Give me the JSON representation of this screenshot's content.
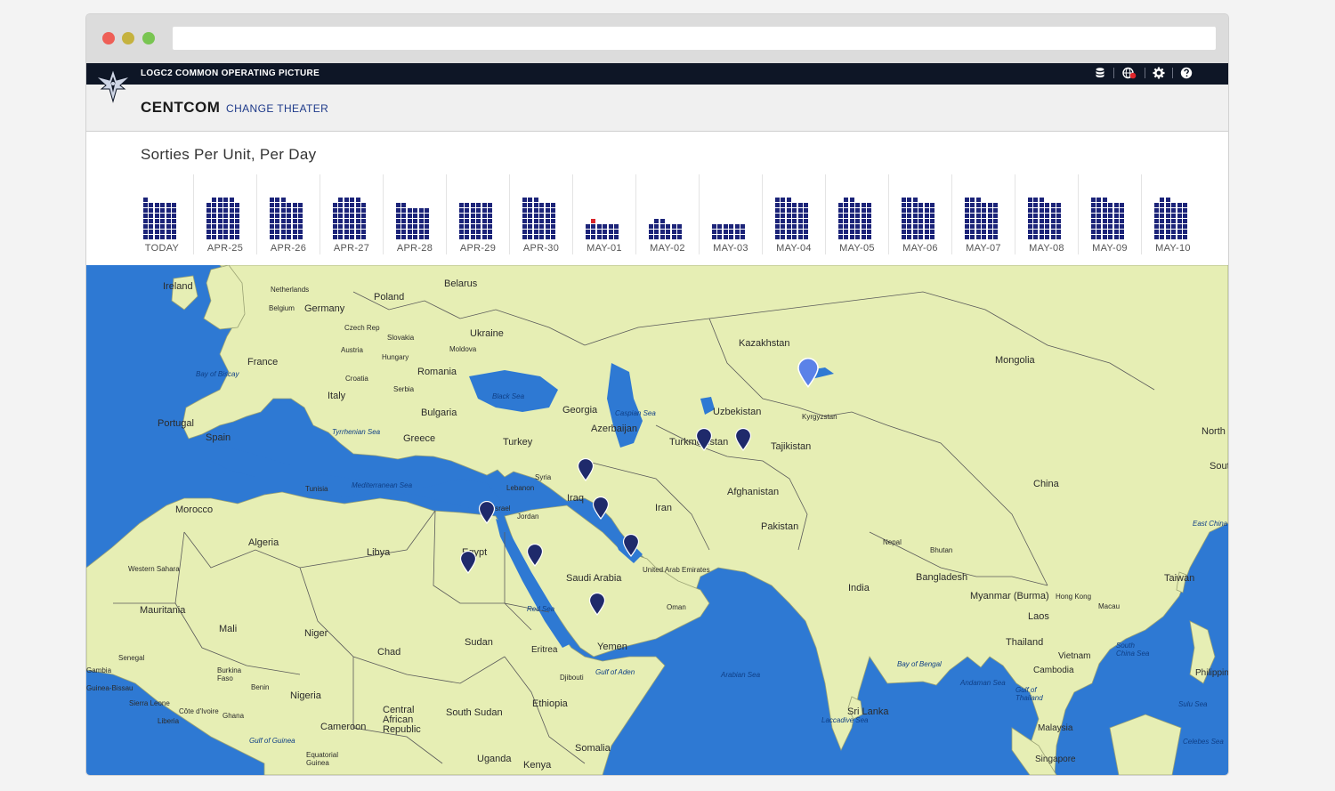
{
  "app": {
    "title": "LOGC2 COMMON OPERATING PICTURE",
    "theater": "CENTCOM",
    "change_theater": "CHANGE THEATER",
    "top_icons": [
      "database-icon",
      "globe-alert-icon",
      "gear-icon",
      "help-icon"
    ]
  },
  "sorties": {
    "title": "Sorties Per Unit, Per Day",
    "days": [
      {
        "label": "TODAY",
        "columns": [
          8,
          7,
          7,
          7,
          7,
          7
        ],
        "alert_cells": 0
      },
      {
        "label": "APR-25",
        "columns": [
          7,
          8,
          8,
          8,
          8,
          7
        ],
        "alert_cells": 0
      },
      {
        "label": "APR-26",
        "columns": [
          8,
          8,
          8,
          7,
          7,
          7
        ],
        "alert_cells": 0
      },
      {
        "label": "APR-27",
        "columns": [
          7,
          8,
          8,
          8,
          8,
          7
        ],
        "alert_cells": 0
      },
      {
        "label": "APR-28",
        "columns": [
          7,
          7,
          6,
          6,
          6,
          6
        ],
        "alert_cells": 0
      },
      {
        "label": "APR-29",
        "columns": [
          7,
          7,
          7,
          7,
          7,
          7
        ],
        "alert_cells": 0
      },
      {
        "label": "APR-30",
        "columns": [
          8,
          8,
          8,
          7,
          7,
          7
        ],
        "alert_cells": 0
      },
      {
        "label": "MAY-01",
        "columns": [
          3,
          4,
          3,
          3,
          3,
          3
        ],
        "alert_cells": 1
      },
      {
        "label": "MAY-02",
        "columns": [
          3,
          4,
          4,
          3,
          3,
          3
        ],
        "alert_cells": 0
      },
      {
        "label": "MAY-03",
        "columns": [
          3,
          3,
          3,
          3,
          3,
          3
        ],
        "alert_cells": 0
      },
      {
        "label": "MAY-04",
        "columns": [
          8,
          8,
          8,
          7,
          7,
          7
        ],
        "alert_cells": 0
      },
      {
        "label": "MAY-05",
        "columns": [
          7,
          8,
          8,
          7,
          7,
          7
        ],
        "alert_cells": 0
      },
      {
        "label": "MAY-06",
        "columns": [
          8,
          8,
          8,
          7,
          7,
          7
        ],
        "alert_cells": 0
      },
      {
        "label": "MAY-07",
        "columns": [
          8,
          8,
          8,
          7,
          7,
          7
        ],
        "alert_cells": 0
      },
      {
        "label": "MAY-08",
        "columns": [
          8,
          8,
          8,
          7,
          7,
          7
        ],
        "alert_cells": 0
      },
      {
        "label": "MAY-09",
        "columns": [
          8,
          8,
          8,
          7,
          7,
          7
        ],
        "alert_cells": 0
      },
      {
        "label": "MAY-10",
        "columns": [
          7,
          8,
          8,
          7,
          7,
          7
        ],
        "alert_cells": 0
      }
    ]
  },
  "map": {
    "countries": [
      "Ireland",
      "Netherlands",
      "Belgium",
      "Poland",
      "Belarus",
      "Germany",
      "Czech Rep",
      "Slovakia",
      "Ukraine",
      "France",
      "Austria",
      "Hungary",
      "Moldova",
      "Romania",
      "Croatia",
      "Serbia",
      "Italy",
      "Bulgaria",
      "Portugal",
      "Spain",
      "Greece",
      "Turkey",
      "Georgia",
      "Azerbaijan",
      "Kazakhstan",
      "Uzbekistan",
      "Kyrgyzstan",
      "Turkmenistan",
      "Tajikistan",
      "Mongolia",
      "Tunisia",
      "Lebanon",
      "Syria",
      "Israel",
      "Jordan",
      "Iraq",
      "Iran",
      "Afghanistan",
      "Pakistan",
      "Morocco",
      "Algeria",
      "Libya",
      "Egypt",
      "Western Sahara",
      "Saudi Arabia",
      "United Arab Emirates",
      "Nepal",
      "Bhutan",
      "China",
      "Mauritania",
      "Mali",
      "Niger",
      "Oman",
      "India",
      "Bangladesh",
      "Myanmar (Burma)",
      "Hong Kong",
      "Taiwan",
      "Macau",
      "Laos",
      "Senegal",
      "Chad",
      "Sudan",
      "Eritrea",
      "Yemen",
      "Thailand",
      "Burkina Faso",
      "Benin",
      "Nigeria",
      "Vietnam",
      "Cambodia",
      "Philippines",
      "Côte d'Ivoire",
      "Ghana",
      "Liberia",
      "Djibouti",
      "Ethiopia",
      "Central African Republic",
      "South Sudan",
      "Cameroon",
      "Sri Lanka",
      "Malaysia",
      "Equatorial Guinea",
      "Uganda",
      "Kenya",
      "Somalia",
      "Singapore",
      "Gambia",
      "Guinea-Bissau",
      "Sierra Leone",
      "North",
      "South"
    ],
    "seas": [
      "Bay of Biscay",
      "Black Sea",
      "Caspian Sea",
      "Tyrrhenian Sea",
      "Mediterranean Sea",
      "Red Sea",
      "Gulf of Aden",
      "Arabian Sea",
      "Bay of Bengal",
      "Andaman Sea",
      "Gulf of Thailand",
      "South China Sea",
      "East China Sea",
      "Sulu Sea",
      "Celebes Sea",
      "Laccadive Sea",
      "Gulf of Guinea"
    ],
    "colors": {
      "water": "#2e79d3",
      "land": "#e6eeb4",
      "pin": "#1f2a6b",
      "pin_selected": "#5b82e8"
    }
  }
}
